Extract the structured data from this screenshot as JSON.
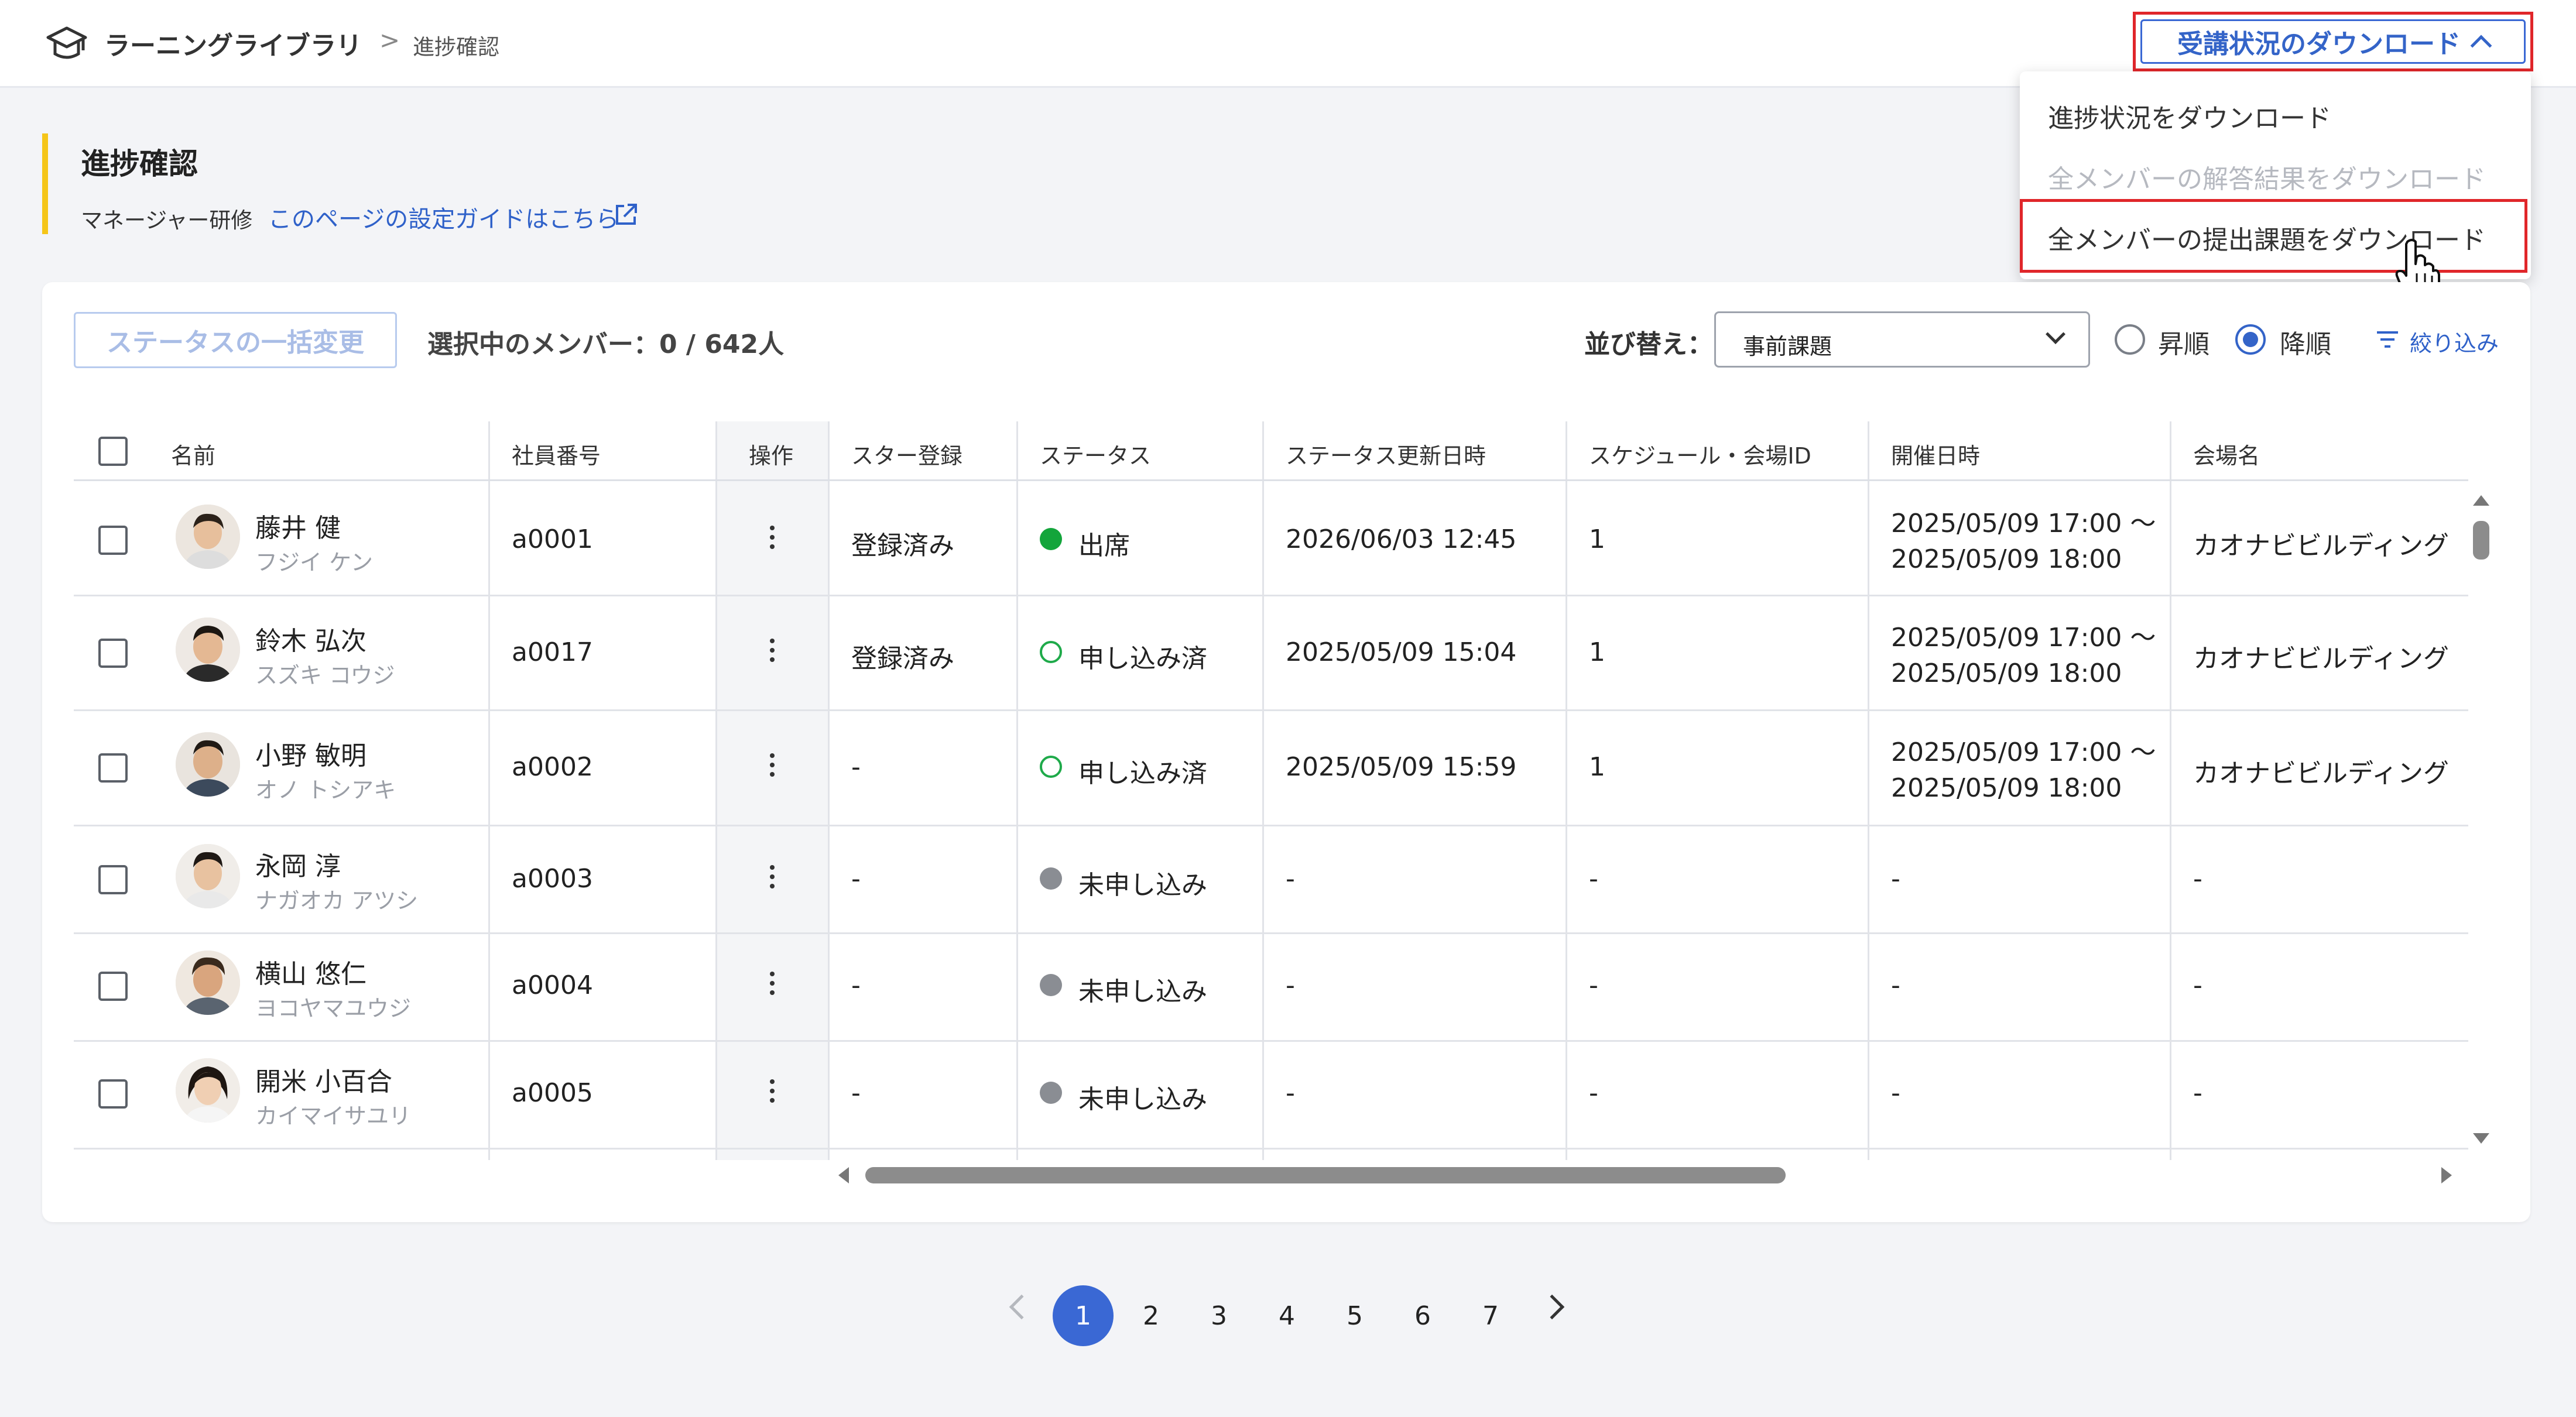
{
  "header": {
    "app_title": "ラーニングライブラリ",
    "breadcrumb_sep": ">",
    "breadcrumb_current": "進捗確認",
    "download_button": "受講状況のダウンロード"
  },
  "download_menu": {
    "items": [
      {
        "label": "進捗状況をダウンロード",
        "disabled": false
      },
      {
        "label": "全メンバーの解答結果をダウンロード",
        "disabled": true
      },
      {
        "label": "全メンバーの提出課題をダウンロード",
        "disabled": false,
        "highlighted": true
      }
    ]
  },
  "page": {
    "title": "進捗確認",
    "subtitle": "マネージャー研修",
    "guide_link": "このページの設定ガイドはこちら"
  },
  "toolbar": {
    "bulk_button": "ステータスの一括変更",
    "selected_count": "選択中のメンバー：0 / 642人",
    "sort_label": "並び替え：",
    "sort_value": "事前課題",
    "order_asc": "昇順",
    "order_desc": "降順",
    "order_selected": "desc",
    "filter_link": "絞り込み"
  },
  "table": {
    "headers": [
      "名前",
      "社員番号",
      "操作",
      "スター登録",
      "ステータス",
      "ステータス更新日時",
      "スケジュール・会場ID",
      "開催日時",
      "会場名"
    ],
    "rows": [
      {
        "name": "藤井 健",
        "kana": "フジイ ケン",
        "id": "a0001",
        "star": "登録済み",
        "status": "出席",
        "status_type": "attended",
        "updated": "2026/06/03 12:45",
        "schedule_id": "1",
        "date_line1": "2025/05/09 17:00 〜",
        "date_line2": "2025/05/09 18:00",
        "venue": "カオナビビルディング"
      },
      {
        "name": "鈴木 弘次",
        "kana": "スズキ コウジ",
        "id": "a0017",
        "star": "登録済み",
        "status": "申し込み済",
        "status_type": "applied",
        "updated": "2025/05/09 15:04",
        "schedule_id": "1",
        "date_line1": "2025/05/09 17:00 〜",
        "date_line2": "2025/05/09 18:00",
        "venue": "カオナビビルディング"
      },
      {
        "name": "小野 敏明",
        "kana": "オノ トシアキ",
        "id": "a0002",
        "star": "-",
        "status": "申し込み済",
        "status_type": "applied",
        "updated": "2025/05/09 15:59",
        "schedule_id": "1",
        "date_line1": "2025/05/09 17:00 〜",
        "date_line2": "2025/05/09 18:00",
        "venue": "カオナビビルディング"
      },
      {
        "name": "永岡 淳",
        "kana": "ナガオカ アツシ",
        "id": "a0003",
        "star": "-",
        "status": "未申し込み",
        "status_type": "none",
        "updated": "-",
        "schedule_id": "-",
        "date_line1": "-",
        "date_line2": "",
        "venue": "-"
      },
      {
        "name": "横山 悠仁",
        "kana": "ヨコヤマユウジ",
        "id": "a0004",
        "star": "-",
        "status": "未申し込み",
        "status_type": "none",
        "updated": "-",
        "schedule_id": "-",
        "date_line1": "-",
        "date_line2": "",
        "venue": "-"
      },
      {
        "name": "開米 小百合",
        "kana": "カイマイサユリ",
        "id": "a0005",
        "star": "-",
        "status": "未申し込み",
        "status_type": "none",
        "updated": "-",
        "schedule_id": "-",
        "date_line1": "-",
        "date_line2": "",
        "venue": "-"
      }
    ]
  },
  "pagination": {
    "pages": [
      "1",
      "2",
      "3",
      "4",
      "5",
      "6",
      "7"
    ],
    "current": "1"
  },
  "icons": {
    "logo": "graduation-cap-icon",
    "external": "external-link-icon",
    "filter": "filter-icon",
    "row_menu": "kebab-menu-icon"
  },
  "colors": {
    "accent": "#3464c8",
    "highlight": "#e0262a",
    "attended": "#13a53b",
    "heading_bar": "#f5c518"
  }
}
